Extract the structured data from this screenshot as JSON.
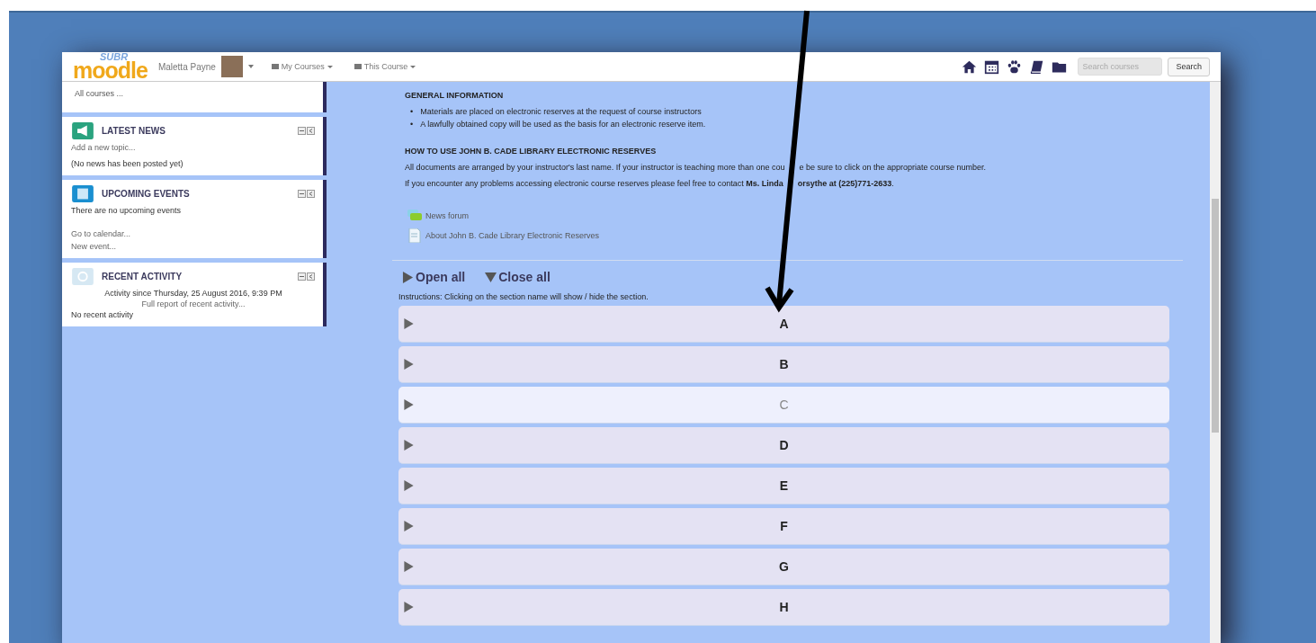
{
  "navbar": {
    "logo_top": "SUBR",
    "logo": "moodle",
    "user": "Maletta Payne",
    "menus": [
      "My Courses",
      "This Course"
    ],
    "search": {
      "placeholder": "Search courses"
    },
    "search_button": "Search"
  },
  "sidebar": {
    "top_link": "All courses ...",
    "blocks": [
      {
        "kind": "news",
        "title": "LATEST NEWS",
        "lines": [
          {
            "text": "Add a new topic...",
            "link": true
          },
          {
            "text": "(No news has been posted yet)",
            "link": false
          }
        ]
      },
      {
        "kind": "events",
        "title": "UPCOMING EVENTS",
        "lines": [
          {
            "text": "There are no upcoming events",
            "link": false
          },
          {
            "text": "Go to calendar...",
            "link": true
          },
          {
            "text": "New event...",
            "link": true
          }
        ]
      },
      {
        "kind": "activity",
        "title": "RECENT ACTIVITY",
        "lines": [
          {
            "text": "Activity since Thursday, 25 August 2016, 9:39 PM",
            "link": false
          },
          {
            "text": "Full report of recent activity...",
            "link": true
          },
          {
            "text": "No recent activity",
            "link": false
          }
        ]
      }
    ]
  },
  "main": {
    "heading1": "GENERAL INFORMATION",
    "bullets": [
      {
        "marker": "•",
        "text": "Materials are placed on electronic reserves at the request of course instructors"
      },
      {
        "marker": "•",
        "text": "A lawfully obtained copy will be used as the basis for an electronic reserve item."
      }
    ],
    "heading2": "HOW TO USE JOHN B. CADE LIBRARY ELECTRONIC RESERVES",
    "para1": [
      "All documents are arranged by your instructor's last name. If your instructor is teaching more than one cou",
      "e be sure to click on the appropriate course number."
    ],
    "para2": [
      "If you encounter any problems accessing electronic course reserves please feel free to contact **Ms. Linda**",
      "**orsythe at (225)771-2633**."
    ],
    "resources": [
      {
        "kind": "forum",
        "label": "News forum"
      },
      {
        "kind": "page",
        "label": "About John B. Cade Library Electronic Reserves"
      }
    ],
    "open_all": "Open all",
    "close_all": "Close all",
    "instructions": "Instructions: Clicking on the section name will show / hide the section.",
    "sections": [
      {
        "label": "A",
        "highlighted": false
      },
      {
        "label": "B",
        "highlighted": false
      },
      {
        "label": "C",
        "highlighted": true
      },
      {
        "label": "D",
        "highlighted": false
      },
      {
        "label": "E",
        "highlighted": false
      },
      {
        "label": "F",
        "highlighted": false
      },
      {
        "label": "G",
        "highlighted": false
      },
      {
        "label": "H",
        "highlighted": false
      }
    ]
  }
}
